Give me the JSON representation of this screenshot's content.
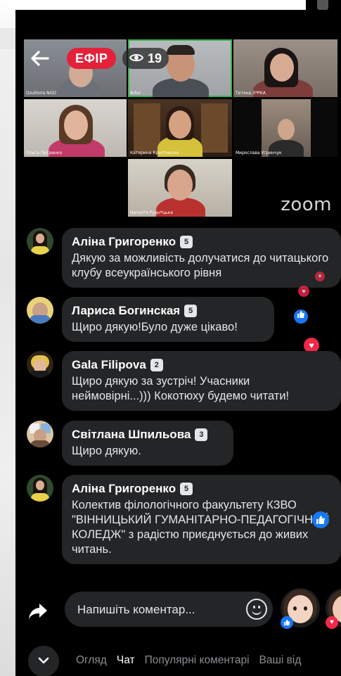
{
  "stream": {
    "live_label": "ЕФІР",
    "viewer_count": "19",
    "watermark": "zoom",
    "participants": [
      {
        "name": "Ozultoria NGO"
      },
      {
        "name": "Artur"
      },
      {
        "name": "Тетяна З*РКА"
      },
      {
        "name": "Ольга Петренко"
      },
      {
        "name": "Катерина Креп*ньска"
      },
      {
        "name": "Мирослава Угринчук"
      },
      {
        "name": "Натал*я Рудн*цька"
      }
    ]
  },
  "comments": [
    {
      "author": "Аліна Григоренко",
      "badge": "5",
      "text": "Дякую за можливість долучатися до читацького клубу всеукраїнського рівня"
    },
    {
      "author": "Лариса Богинская",
      "badge": "5",
      "text": "Щиро дякую!Було дуже цікаво!"
    },
    {
      "author": "Gala Filipova",
      "badge": "2",
      "text": "Щиро дякую за зустріч! Учасники неймовірні...))) Кокотюху будемо читати!"
    },
    {
      "author": "Світлана Шпильова",
      "badge": "3",
      "text": "Щиро дякую."
    },
    {
      "author": "Аліна Григоренко",
      "badge": "5",
      "text": "Колектив філологічного факультету КЗВО \"ВІННИЦЬКИЙ ГУМАНІТАРНО-ПЕДАГОГІЧНИЙ КОЛЕДЖ\" з радістю приєднується до живих читань."
    }
  ],
  "composer": {
    "placeholder": "Напишіть коментар..."
  },
  "tabs": [
    {
      "label": "Огляд"
    },
    {
      "label": "Чат"
    },
    {
      "label": "Популярні коментарі"
    },
    {
      "label": "Ваші від"
    }
  ],
  "colors": {
    "live": "#e4213a",
    "like": "#1877f2",
    "love": "#f02849",
    "bubble": "#242526",
    "active_speaker": "#39b54a"
  }
}
